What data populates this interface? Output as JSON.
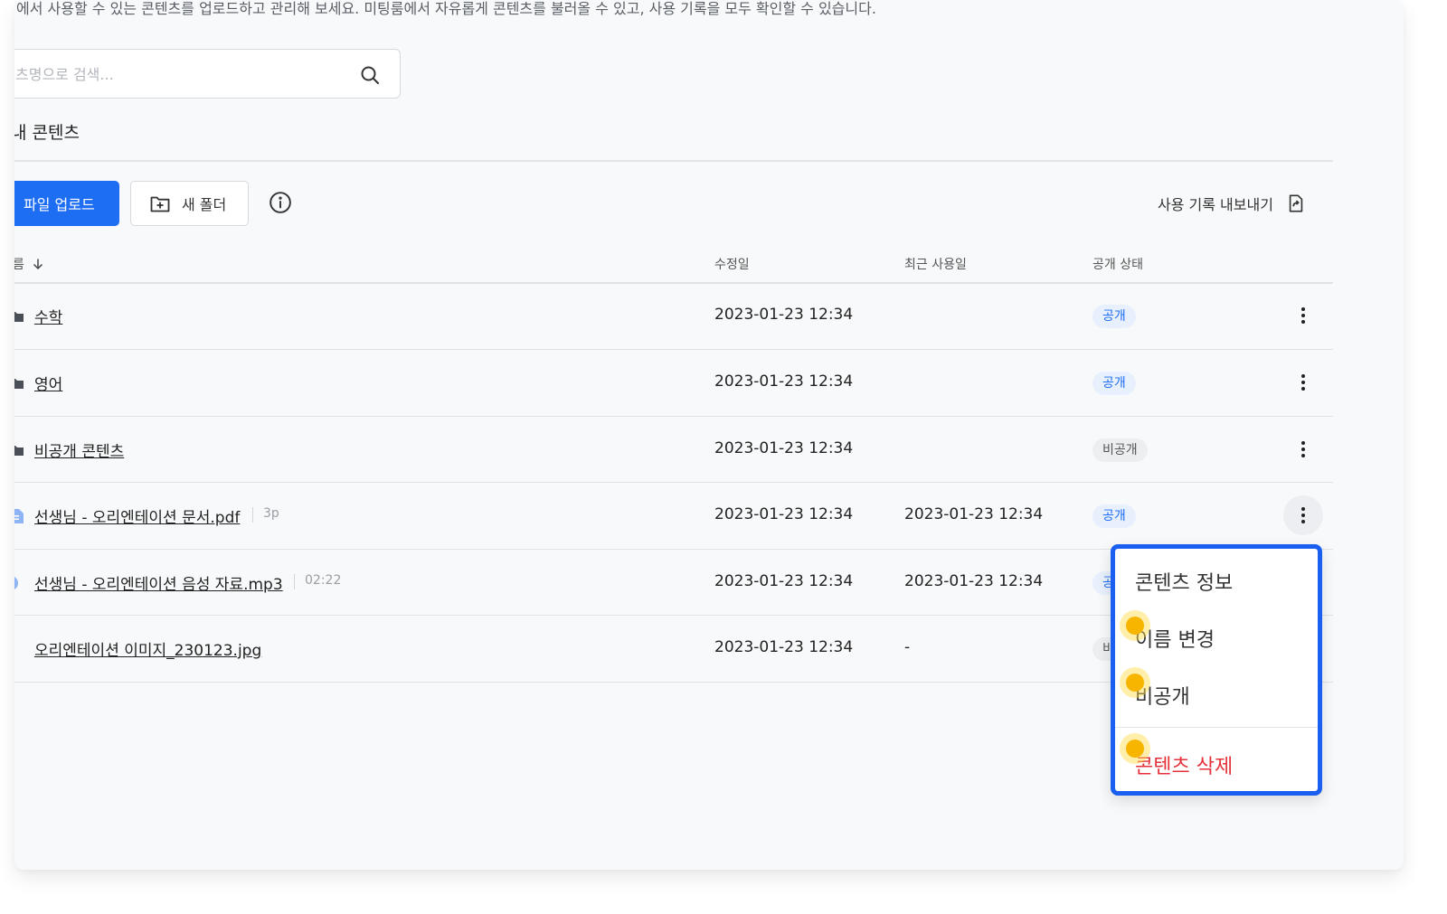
{
  "description": "에서 사용할 수 있는 콘텐츠를 업로드하고 관리해 보세요. 미팅룸에서 자유롭게 콘텐츠를 불러올 수 있고, 사용 기록을 모두 확인할 수 있습니다.",
  "search": {
    "placeholder": "츠명으로 검색...",
    "icon": "search-icon"
  },
  "section_title": "내 콘텐츠",
  "toolbar": {
    "upload_label": "파일 업로드",
    "new_folder_label": "새 폴더",
    "export_label": "사용 기록 내보내기"
  },
  "table": {
    "headers": {
      "name": "름",
      "modified": "수정일",
      "last_used": "최근 사용일",
      "status": "공개 상태"
    },
    "rows": [
      {
        "type": "folder",
        "name": "수학",
        "meta": "",
        "modified": "2023-01-23 12:34",
        "last_used": "",
        "status": "공개"
      },
      {
        "type": "folder",
        "name": "영어",
        "meta": "",
        "modified": "2023-01-23 12:34",
        "last_used": "",
        "status": "공개"
      },
      {
        "type": "folder",
        "name": "비공개 콘텐츠",
        "meta": "",
        "modified": "2023-01-23 12:34",
        "last_used": "",
        "status": "비공개"
      },
      {
        "type": "pdf",
        "name": "선생님 - 오리엔테이션 문서.pdf",
        "meta": "3p",
        "modified": "2023-01-23 12:34",
        "last_used": "2023-01-23 12:34",
        "status": "공개"
      },
      {
        "type": "audio",
        "name": "선생님 - 오리엔테이션 음성 자료.mp3",
        "meta": "02:22",
        "modified": "2023-01-23 12:34",
        "last_used": "2023-01-23 12:34",
        "status": "공"
      },
      {
        "type": "image",
        "name": "오리엔테이션 이미지_230123.jpg",
        "meta": "",
        "modified": "2023-01-23 12:34",
        "last_used": "-",
        "status": "비"
      }
    ]
  },
  "context_menu": {
    "items": [
      "콘텐츠 정보",
      "이름 변경",
      "비공개",
      "콘텐츠 삭제"
    ]
  },
  "colors": {
    "primary": "#1e6ef3",
    "danger": "#e5323a",
    "menu_border": "#1a5ff0",
    "cursor": "#f7b500"
  }
}
